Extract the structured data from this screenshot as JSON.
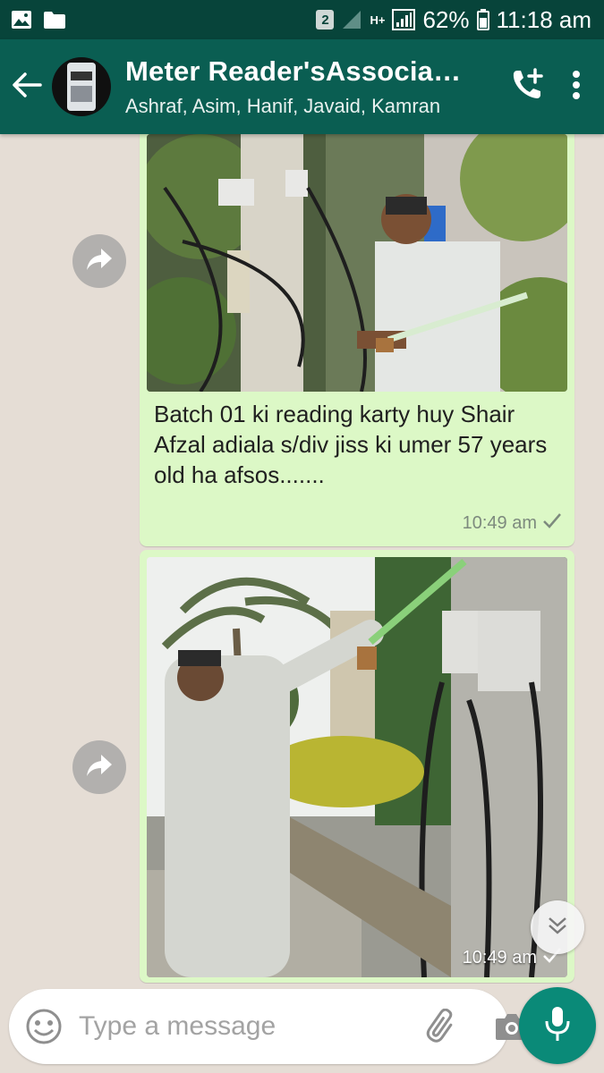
{
  "status_bar": {
    "sim_badge": "2",
    "network": "H+",
    "battery": "62%",
    "time": "11:18 am",
    "icons": [
      "image-icon",
      "folder-icon",
      "signal-icon",
      "battery-icon"
    ]
  },
  "header": {
    "title": "Meter Reader'sAssociation",
    "subtitle": "Ashraf, Asim, Hanif, Javaid, Kamran",
    "icons": [
      "back-arrow-icon",
      "add-call-icon",
      "more-vert-icon"
    ]
  },
  "messages": [
    {
      "type": "image",
      "caption": "Batch 01 ki reading karty huy Shair Afzal adiala s/div jiss ki umer 57 years old ha afsos.......",
      "time": "10:49 am",
      "status": "sent"
    },
    {
      "type": "image",
      "caption": "",
      "time": "10:49 am",
      "status": "sent"
    }
  ],
  "composer": {
    "placeholder": "Type a message",
    "icons": [
      "emoji-icon",
      "attach-icon",
      "camera-icon",
      "mic-icon"
    ]
  },
  "colors": {
    "header": "#0a5e52",
    "status_bar": "#07443a",
    "bubble": "#dcf8c6",
    "chat_bg": "#e5ddd5",
    "accent": "#0a8a78"
  }
}
